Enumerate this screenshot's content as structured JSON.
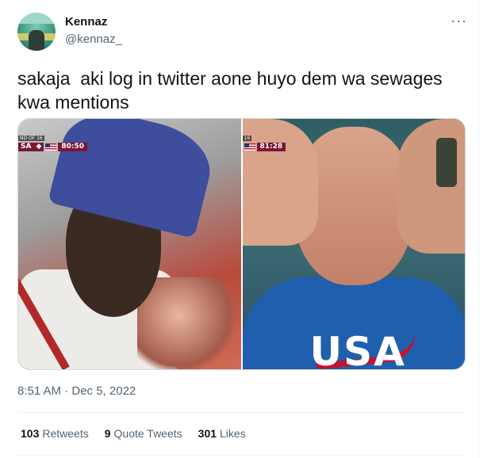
{
  "author": {
    "name": "Kennaz",
    "handle": "@kennaz_",
    "avatar_icon": "profile-avatar"
  },
  "menu": {
    "more_label": "···",
    "more_icon": "more-options-icon"
  },
  "tweet": {
    "text": "sakaja  aki log in twitter aone huyo dem wa sewages\nkwa mentions",
    "timestamp": "8:51 AM · Dec 5, 2022"
  },
  "media": {
    "left": {
      "round": "ND OF 16",
      "team": "SA",
      "team_marker": "◆",
      "clock": "80:50"
    },
    "right": {
      "round": "16",
      "clock": "81:28",
      "shirt_text": "USA"
    }
  },
  "stats": [
    {
      "count": "103",
      "label": "Retweets"
    },
    {
      "count": "9",
      "label": "Quote Tweets"
    },
    {
      "count": "301",
      "label": "Likes"
    }
  ],
  "colors": {
    "text_primary": "#0f1419",
    "text_secondary": "#536471",
    "divider": "#eff3f4",
    "scoreboard": "#7a1636"
  }
}
